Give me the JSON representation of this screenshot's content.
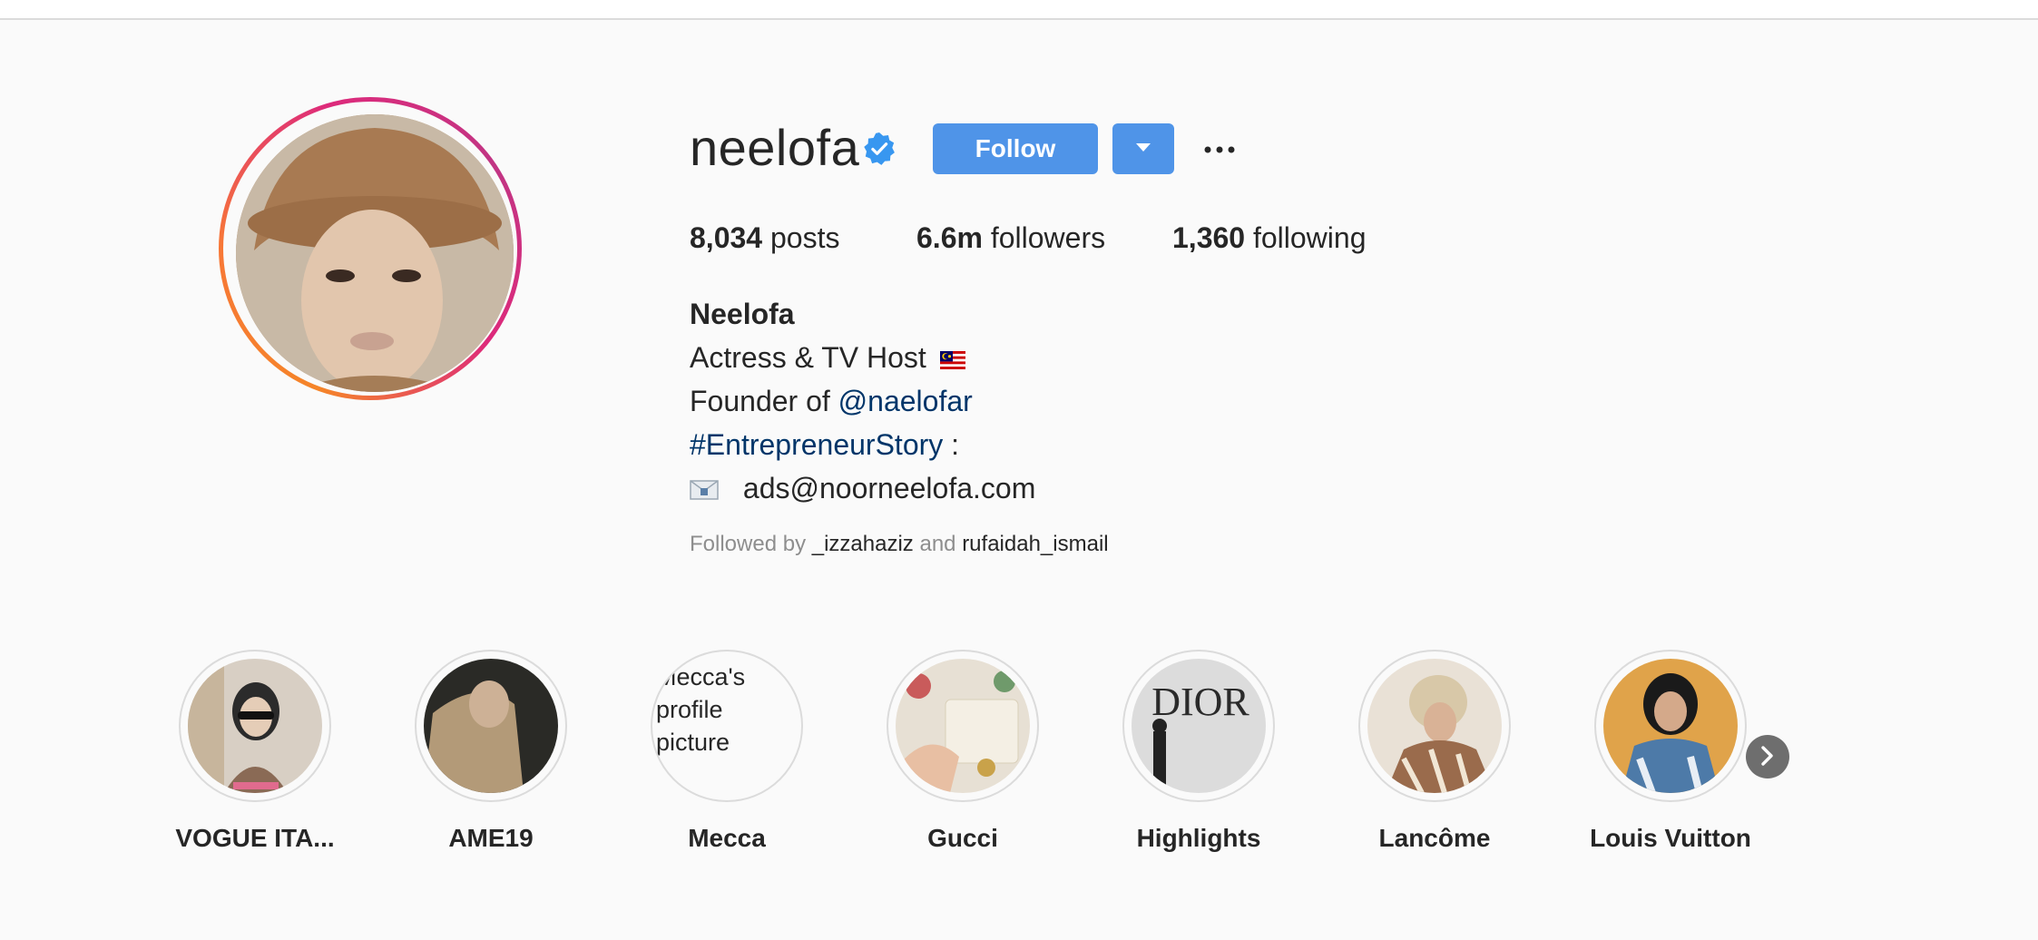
{
  "profile": {
    "username": "neelofa",
    "follow_label": "Follow",
    "stats": {
      "posts_count": "8,034",
      "posts_label": "posts",
      "followers_count": "6.6m",
      "followers_label": "followers",
      "following_count": "1,360",
      "following_label": "following"
    },
    "bio": {
      "full_name": "Neelofa",
      "line1": "Actress & TV Host",
      "line2_prefix": "Founder of",
      "line2_link": "@naelofar",
      "line3_link": "#EntrepreneurStory",
      "line3_suffix": ":",
      "email": "ads@noorneelofa.com"
    },
    "followed_by": {
      "prefix": "Followed by",
      "user1": "_izzahaziz",
      "conjunction": "and",
      "user2": "rufaidah_ismail"
    }
  },
  "highlights": [
    {
      "label": "VOGUE ITA..."
    },
    {
      "label": "AME19"
    },
    {
      "label": "Mecca",
      "broken_image_alt": "Mecca's profile picture"
    },
    {
      "label": "Gucci"
    },
    {
      "label": "Highlights",
      "image_text": "DIOR"
    },
    {
      "label": "Lancôme"
    },
    {
      "label": "Louis Vuitton"
    }
  ],
  "colors": {
    "follow_blue": "#4f94e8",
    "link_blue": "#003569",
    "verified_blue": "#3897f0",
    "muted": "#8e8e8e"
  },
  "icons": {
    "verified": "verified-badge-icon",
    "dropdown": "caret-down-icon",
    "more": "ellipsis-icon",
    "flag": "malaysia-flag-icon",
    "email": "envelope-icon",
    "next": "chevron-right-icon"
  }
}
